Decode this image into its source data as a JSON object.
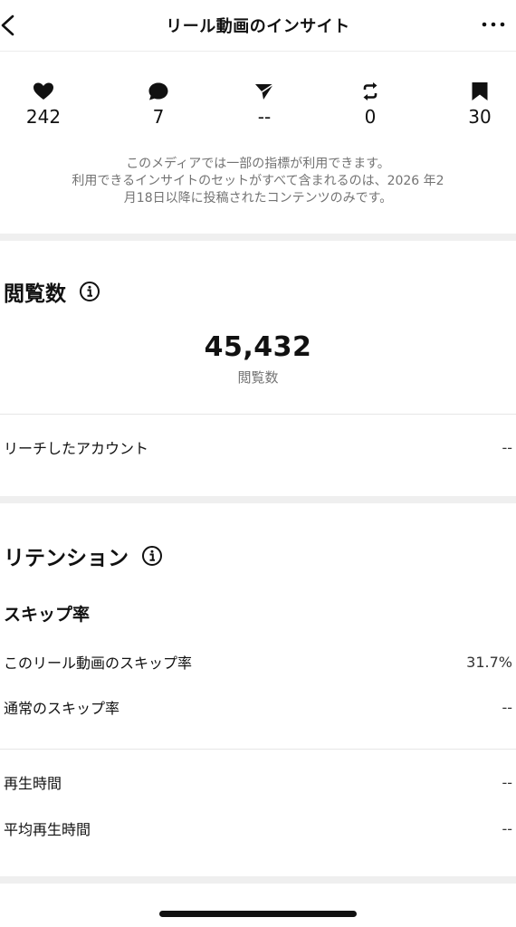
{
  "header": {
    "title": "リール動画のインサイト"
  },
  "stats": [
    {
      "icon": "heart-icon",
      "value": "242"
    },
    {
      "icon": "comment-icon",
      "value": "7"
    },
    {
      "icon": "share-icon",
      "value": "--"
    },
    {
      "icon": "repost-icon",
      "value": "0"
    },
    {
      "icon": "bookmark-icon",
      "value": "30"
    }
  ],
  "notice": {
    "line1": "このメディアでは一部の指標が利用できます。",
    "line2": "利用できるインサイトのセットがすべて含まれるのは、2026 年2",
    "line3": "月18日以降に投稿されたコンテンツのみです。"
  },
  "views": {
    "title": "閲覧数",
    "value": "45,432",
    "label": "閲覧数",
    "reach_label": "リーチしたアカウント",
    "reach_value": "--"
  },
  "retention": {
    "title": "リテンション",
    "skip_heading": "スキップ率",
    "rows": [
      {
        "label": "このリール動画のスキップ率",
        "value": "31.7%"
      },
      {
        "label": "通常のスキップ率",
        "value": "--"
      }
    ],
    "time_rows": [
      {
        "label": "再生時間",
        "value": "--"
      },
      {
        "label": "平均再生時間",
        "value": "--"
      }
    ]
  }
}
